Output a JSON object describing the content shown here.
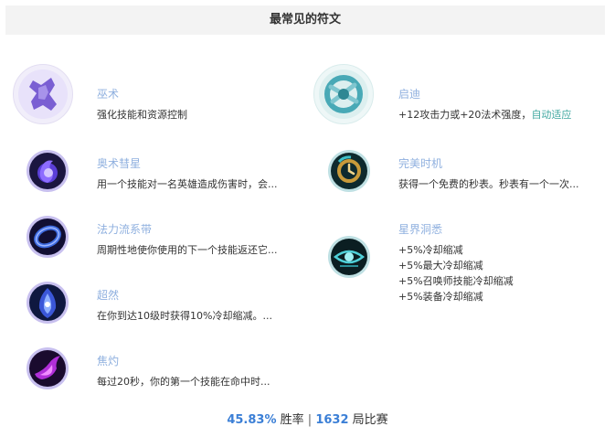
{
  "header": {
    "title": "最常见的符文"
  },
  "left_runes": [
    {
      "name": "巫术",
      "desc": "强化技能和资源控制",
      "icon": "sorcery-path-icon"
    },
    {
      "name": "奥术彗星",
      "desc": "用一个技能对一名英雄造成伤害时，会...",
      "icon": "arcane-comet-icon"
    },
    {
      "name": "法力流系带",
      "desc": "周期性地使你使用的下一个技能返还它...",
      "icon": "manaflow-band-icon"
    },
    {
      "name": "超然",
      "desc": "在你到达10级时获得10%冷却缩减。...",
      "icon": "transcendence-icon"
    },
    {
      "name": "焦灼",
      "desc": "每过20秒，你的第一个技能在命中时...",
      "icon": "scorch-icon"
    }
  ],
  "right_runes": [
    {
      "name": "启迪",
      "desc_prefix": "+12攻击力或+20法术强度，",
      "desc_highlight": "自动适应",
      "icon": "inspiration-path-icon"
    },
    {
      "name": "完美时机",
      "desc": "获得一个免费的秒表。秒表有一个一次...",
      "icon": "perfect-timing-icon"
    },
    {
      "name": "星界洞悉",
      "desc_lines": [
        "+5%冷却缩减",
        "+5%最大冷却缩减",
        "+5%召唤师技能冷却缩减",
        "+5%装备冷却缩减"
      ],
      "icon": "cosmic-insight-icon"
    }
  ],
  "stats": {
    "win_rate": "45.83%",
    "win_rate_label": "胜率",
    "separator": "|",
    "games": "1632",
    "games_label": "局比赛"
  },
  "colors": {
    "rune_name": "#8fb0df",
    "highlight": "#3fa7a0",
    "stat_number": "#3b7fd6",
    "header_bg": "#f3f3f3"
  }
}
